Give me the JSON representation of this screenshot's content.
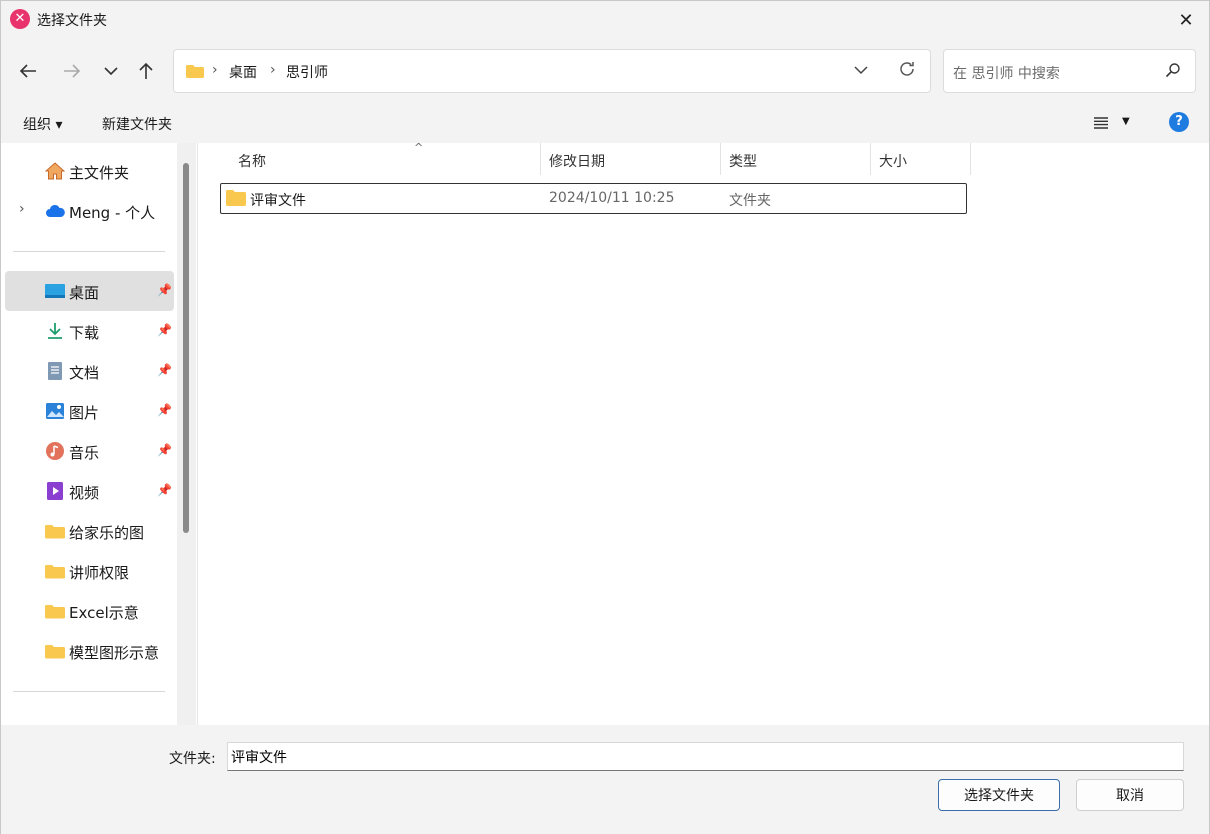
{
  "window": {
    "title": "选择文件夹"
  },
  "navigation": {
    "breadcrumbs": [
      "桌面",
      "思引师"
    ],
    "search_placeholder": "在 思引师 中搜索"
  },
  "toolbar": {
    "organize_label": "组织 ▾",
    "new_folder_label": "新建文件夹"
  },
  "sidebar": {
    "top_items": [
      {
        "label": "主文件夹",
        "icon": "home-icon"
      },
      {
        "label": "Meng - 个人",
        "icon": "cloud-icon"
      }
    ],
    "pinned_items": [
      {
        "label": "桌面",
        "icon": "desktop-icon",
        "selected": true
      },
      {
        "label": "下载",
        "icon": "download-icon"
      },
      {
        "label": "文档",
        "icon": "document-icon"
      },
      {
        "label": "图片",
        "icon": "pictures-icon"
      },
      {
        "label": "音乐",
        "icon": "music-icon"
      },
      {
        "label": "视频",
        "icon": "video-icon"
      }
    ],
    "folder_items": [
      {
        "label": "给家乐的图",
        "icon": "folder-icon"
      },
      {
        "label": "讲师权限",
        "icon": "folder-icon"
      },
      {
        "label": "Excel示意",
        "icon": "folder-icon"
      },
      {
        "label": "模型图形示意",
        "icon": "folder-icon"
      }
    ]
  },
  "file_list": {
    "columns": [
      "名称",
      "修改日期",
      "类型",
      "大小"
    ],
    "rows": [
      {
        "name": "评审文件",
        "modified": "2024/10/11 10:25",
        "type": "文件夹",
        "size": ""
      }
    ]
  },
  "footer": {
    "folder_label": "文件夹:",
    "folder_value": "评审文件",
    "select_button": "选择文件夹",
    "cancel_button": "取消"
  },
  "colors": {
    "accent": "#1e7ce0",
    "folder": "#f8c94e",
    "app_icon": "#e8336d"
  }
}
